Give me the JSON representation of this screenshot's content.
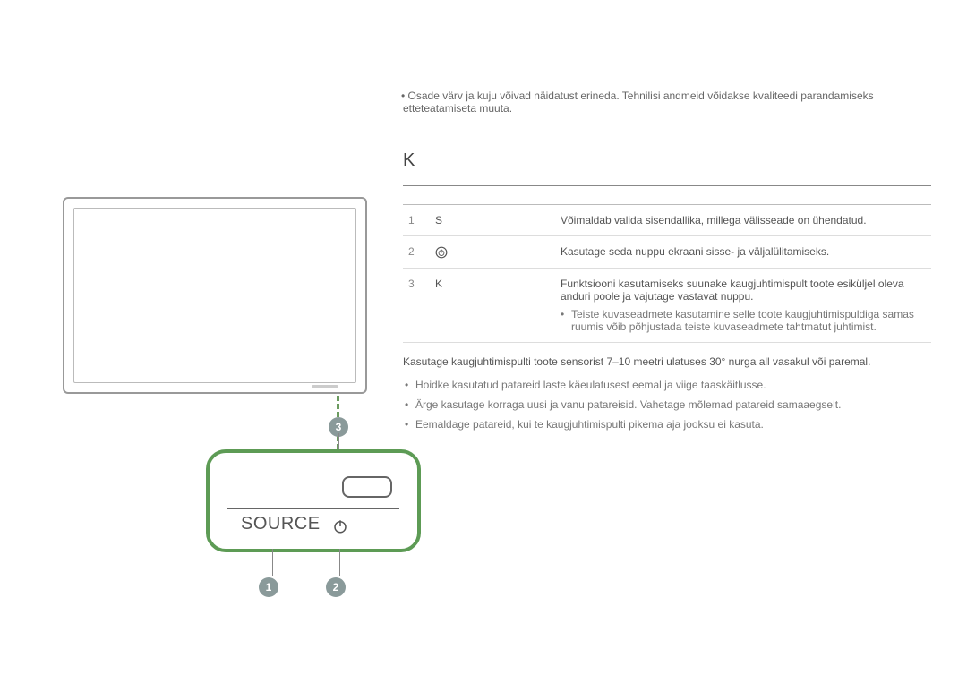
{
  "top_note": "Osade värv ja kuju võivad näidatust erineda. Tehnilisi andmeid võidakse kvaliteedi parandamiseks etteteatamiseta muuta.",
  "section_title": "K",
  "table": {
    "header_icon": "",
    "header_desc": "",
    "rows": [
      {
        "num": "1",
        "name": "S",
        "desc": "Võimaldab valida sisendallika, millega välisseade on ühendatud."
      },
      {
        "num": "2",
        "name": "power-icon",
        "desc": "Kasutage seda nuppu ekraani sisse- ja väljalülitamiseks."
      },
      {
        "num": "3",
        "name": "K",
        "desc": "Funktsiooni kasutamiseks suunake kaugjuhtimispult toote esiküljel oleva anduri poole ja vajutage vastavat nuppu.",
        "sub": "Teiste kuvaseadmete kasutamine selle toote kaugjuhtimispuldiga samas ruumis võib põhjustada teiste kuvaseadmete tahtmatut juhtimist."
      }
    ]
  },
  "sensor_note": "Kasutage kaugjuhtimispulti toote sensorist 7–10 meetri ulatuses 30° nurga all vasakul või paremal.",
  "bullets": [
    "Hoidke kasutatud patareid laste käeulatusest eemal ja viige taaskäitlusse.",
    "Ärge kasutage korraga uusi ja vanu patareisid. Vahetage mõlemad patareid samaaegselt.",
    "Eemaldage patareid, kui te kaugjuhtimispulti pikema aja jooksu ei kasuta."
  ],
  "panel": {
    "source": "SOURCE",
    "callouts": {
      "1": "1",
      "2": "2",
      "3": "3"
    }
  },
  "chart_data": null
}
